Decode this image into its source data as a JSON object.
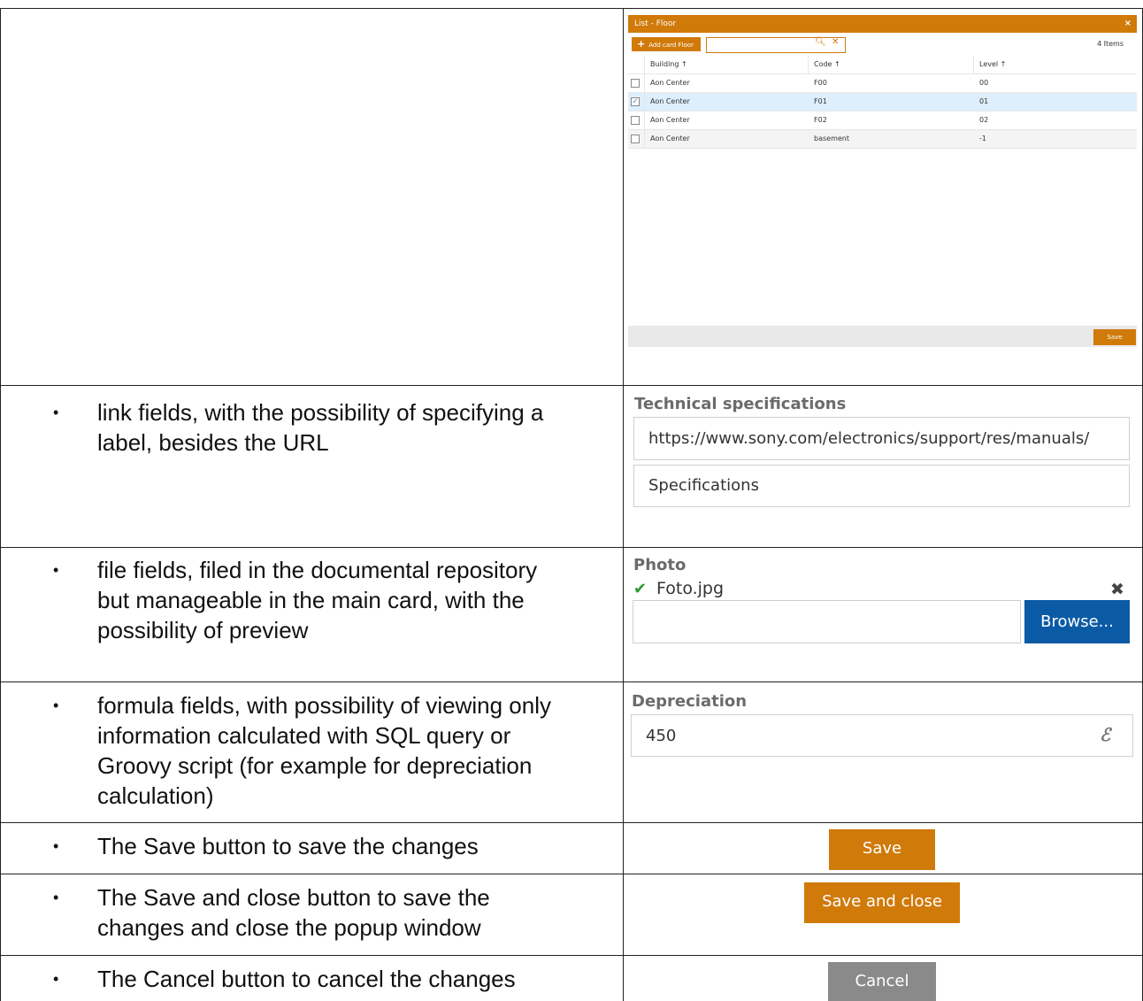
{
  "list_window": {
    "title": "List - Floor",
    "close": "×",
    "add_label": "Add card Floor",
    "search_value": "",
    "item_count": "4 Items",
    "columns": [
      "Building ↑",
      "Code ↑",
      "Level ↑"
    ],
    "rows": [
      {
        "building": "Aon Center",
        "code": "F00",
        "level": "00",
        "checked": false
      },
      {
        "building": "Aon Center",
        "code": "F01",
        "level": "01",
        "checked": true
      },
      {
        "building": "Aon Center",
        "code": "F02",
        "level": "02",
        "checked": false
      },
      {
        "building": "Aon Center",
        "code": "basement",
        "level": "-1",
        "checked": false
      }
    ],
    "save_label": "Save"
  },
  "rows_text": [
    "link fields, with the possibility of specifying a label, besides the URL",
    "file fields, filed in the documental repository but manageable in the main card, with the possibility of preview",
    "formula fields, with possibility of viewing only information calculated with SQL query or Groovy script (for example for depreciation calculation)",
    "The Save button to save the changes",
    "The Save and close button to save the changes and close the popup window",
    "The Cancel button to cancel the changes"
  ],
  "bullet": "•",
  "link_field": {
    "label": "Technical specifications",
    "url": "https://www.sony.com/electronics/support/res/manuals/",
    "text": "Specifications"
  },
  "file_field": {
    "label": "Photo",
    "check": "✔",
    "filename": "Foto.jpg",
    "remove": "✖",
    "input_value": "",
    "browse_label": "Browse..."
  },
  "formula_field": {
    "label": "Depreciation",
    "value": "450",
    "icon": "formula-icon"
  },
  "buttons": {
    "save": "Save",
    "save_close": "Save and close",
    "cancel": "Cancel"
  },
  "colors": {
    "accent": "#d07a0a",
    "browse": "#0b5aa6",
    "cancel": "#8a8a8a"
  }
}
